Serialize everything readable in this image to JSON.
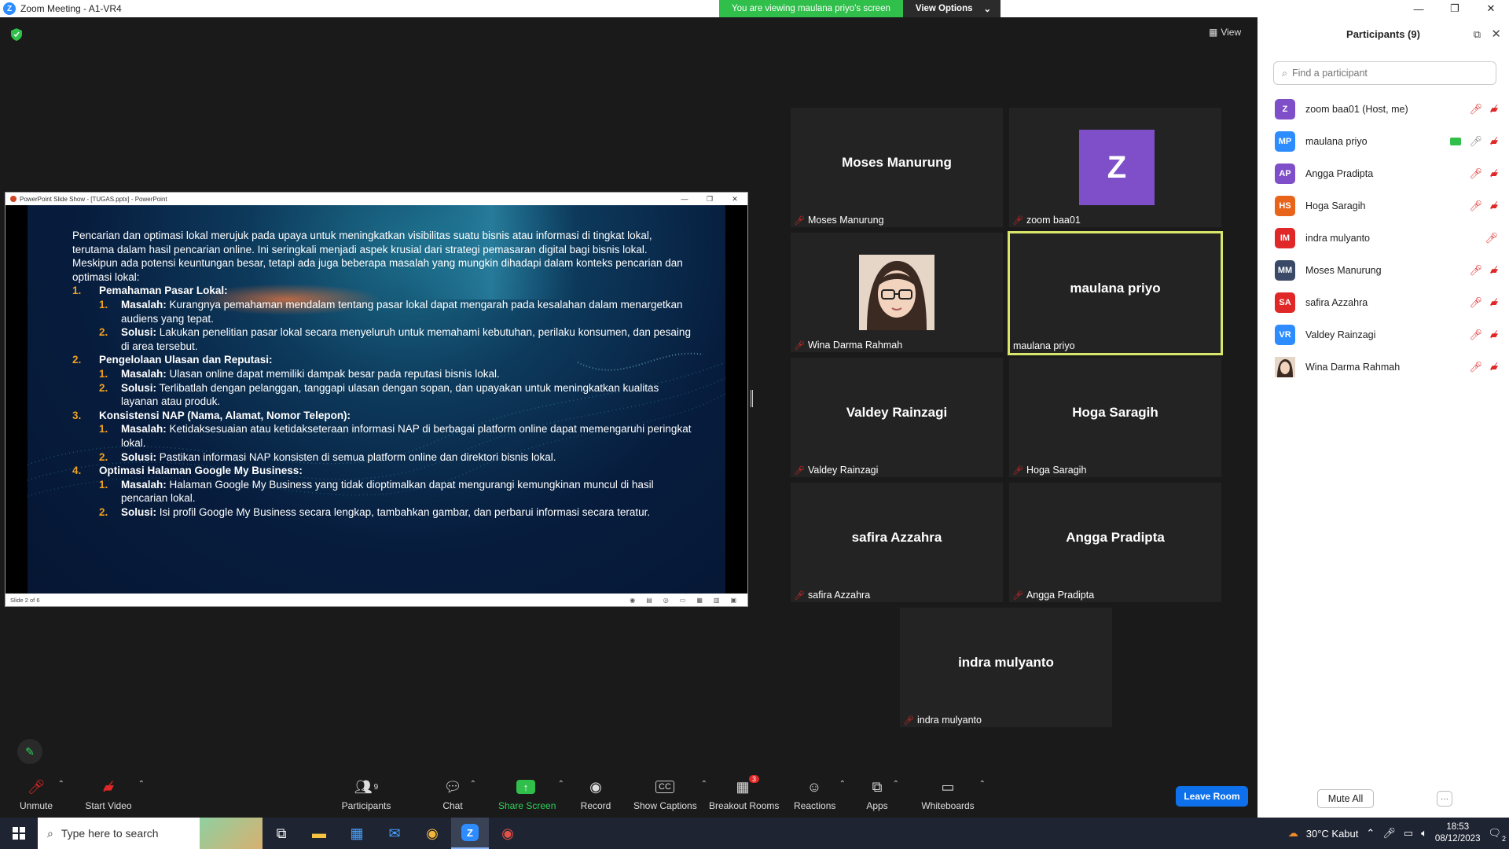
{
  "window": {
    "title": "Zoom Meeting - A1-VR4",
    "banner_text": "You are viewing maulana priyo's screen",
    "view_options": "View Options",
    "view_label": "View"
  },
  "ppt": {
    "title": "PowerPoint Slide Show - [TUGAS.pptx] - PowerPoint",
    "status": "Slide 2 of 6",
    "intro": "Pencarian dan optimasi lokal merujuk pada upaya untuk meningkatkan visibilitas suatu bisnis atau informasi di tingkat lokal, terutama dalam hasil pencarian online. Ini seringkali menjadi aspek krusial dari strategi pemasaran digital bagi bisnis lokal. Meskipun ada potensi keuntungan besar, tetapi ada juga beberapa masalah yang mungkin dihadapi dalam konteks pencarian dan optimasi lokal:",
    "sections": [
      {
        "num": "1.",
        "heading": "Pemahaman Pasar Lokal:",
        "items": [
          {
            "num": "1.",
            "key": "Masalah:",
            "text": "Kurangnya pemahaman mendalam tentang pasar lokal dapat mengarah pada kesalahan dalam menargetkan audiens yang tepat."
          },
          {
            "num": "2.",
            "key": "Solusi:",
            "text": "Lakukan penelitian pasar lokal secara menyeluruh untuk memahami kebutuhan, perilaku konsumen, dan pesaing di area tersebut."
          }
        ]
      },
      {
        "num": "2.",
        "heading": "Pengelolaan Ulasan dan Reputasi:",
        "items": [
          {
            "num": "1.",
            "key": "Masalah:",
            "text": "Ulasan online dapat memiliki dampak besar pada reputasi bisnis lokal."
          },
          {
            "num": "2.",
            "key": "Solusi:",
            "text": "Terlibatlah dengan pelanggan, tanggapi ulasan dengan sopan, dan upayakan untuk meningkatkan kualitas layanan atau produk."
          }
        ]
      },
      {
        "num": "3.",
        "heading": "Konsistensi NAP (Nama, Alamat, Nomor Telepon):",
        "items": [
          {
            "num": "1.",
            "key": "Masalah:",
            "text": "Ketidaksesuaian atau ketidakseteraan informasi NAP di berbagai platform online dapat memengaruhi peringkat lokal."
          },
          {
            "num": "2.",
            "key": "Solusi:",
            "text": "Pastikan informasi NAP konsisten di semua platform online dan direktori bisnis lokal."
          }
        ]
      },
      {
        "num": "4.",
        "heading": "Optimasi Halaman Google My Business:",
        "items": [
          {
            "num": "1.",
            "key": "Masalah:",
            "text": "Halaman Google My Business yang tidak dioptimalkan dapat mengurangi kemungkinan muncul di hasil pencarian lokal."
          },
          {
            "num": "2.",
            "key": "Solusi:",
            "text": "Isi profil Google My Business secara lengkap, tambahkan gambar, dan perbarui informasi secara teratur."
          }
        ]
      }
    ]
  },
  "tiles": [
    {
      "big": "Moses Manurung",
      "label": "Moses Manurung"
    },
    {
      "avatar": "Z",
      "label": "zoom baa01"
    },
    {
      "label": "Wina Darma Rahmah"
    },
    {
      "big": "maulana priyo",
      "label": "maulana priyo"
    },
    {
      "big": "Valdey Rainzagi",
      "label": "Valdey Rainzagi"
    },
    {
      "big": "Hoga Saragih",
      "label": "Hoga Saragih"
    },
    {
      "big": "safira Azzahra",
      "label": "safira Azzahra"
    },
    {
      "big": "Angga Pradipta",
      "label": "Angga Pradipta"
    },
    {
      "big": "indra mulyanto",
      "label": "indra mulyanto"
    }
  ],
  "toolbar": {
    "unmute": "Unmute",
    "start_video": "Start Video",
    "participants": "Participants",
    "participants_count": "9",
    "chat": "Chat",
    "share_screen": "Share Screen",
    "record": "Record",
    "captions": "Show Captions",
    "breakout": "Breakout Rooms",
    "breakout_badge": "3",
    "reactions": "Reactions",
    "apps": "Apps",
    "whiteboards": "Whiteboards",
    "leave": "Leave Room"
  },
  "panel": {
    "title": "Participants (9)",
    "search_placeholder": "Find a participant",
    "participants": [
      {
        "initials": "Z",
        "name": "zoom baa01 (Host, me)",
        "color": "#7e4fc9"
      },
      {
        "initials": "MP",
        "name": "maulana priyo",
        "color": "#2d8cff"
      },
      {
        "initials": "AP",
        "name": "Angga Pradipta",
        "color": "#7e4fc9"
      },
      {
        "initials": "HS",
        "name": "Hoga Saragih",
        "color": "#e8641b"
      },
      {
        "initials": "IM",
        "name": "indra mulyanto",
        "color": "#e02828"
      },
      {
        "initials": "MM",
        "name": "Moses Manurung",
        "color": "#3a4a66"
      },
      {
        "initials": "SA",
        "name": "safira Azzahra",
        "color": "#e02828"
      },
      {
        "initials": "VR",
        "name": "Valdey Rainzagi",
        "color": "#2d8cff"
      },
      {
        "initials": "",
        "name": "Wina Darma Rahmah",
        "color": "#a08070"
      }
    ],
    "mute_all": "Mute All",
    "more": "···"
  },
  "taskbar": {
    "search_placeholder": "Type here to search",
    "weather": "30°C  Kabut",
    "time": "18:53",
    "date": "08/12/2023",
    "notif_count": "2"
  }
}
